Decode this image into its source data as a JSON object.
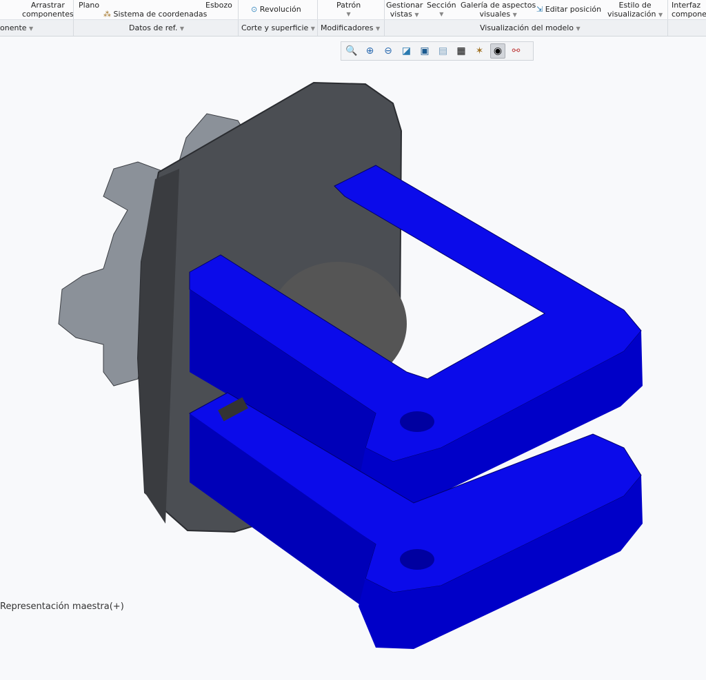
{
  "ribbon": {
    "items": [
      {
        "label1": "Arrastrar",
        "label2": "componentes"
      },
      {
        "label": "Plano"
      },
      {
        "label": "Sistema de coordenadas",
        "icon": "coordinate-system-icon"
      },
      {
        "label": "Esbozo"
      },
      {
        "label": "Revolución",
        "icon": "revolve-icon"
      },
      {
        "label": "Patrón"
      },
      {
        "label1": "Gestionar",
        "label2": "vistas"
      },
      {
        "label": "Sección"
      },
      {
        "label1": "Galería de aspectos",
        "label2": "visuales"
      },
      {
        "label": "Editar posición",
        "icon": "edit-position-icon"
      },
      {
        "label1": "Estilo de",
        "label2": "visualización"
      },
      {
        "label1": "Interfaz",
        "label2": "componentes"
      }
    ],
    "groups": [
      "onente",
      "Datos de ref.",
      "Corte y superficie",
      "Modificadores",
      "Visualización del modelo"
    ]
  },
  "view_toolbar": [
    "refit-icon",
    "zoom-in-icon",
    "zoom-out-icon",
    "repaint-icon",
    "display-style-icon",
    "saved-orientations-icon",
    "view-manager-icon",
    "datum-display-icon",
    "spin-center-icon",
    "annotation-display-icon"
  ],
  "colors": {
    "part_blue": "#0b0bea",
    "part_gray": "#4b4e53",
    "knob_gray": "#8b9199"
  },
  "status": {
    "representation": "Representación maestra(+)"
  }
}
